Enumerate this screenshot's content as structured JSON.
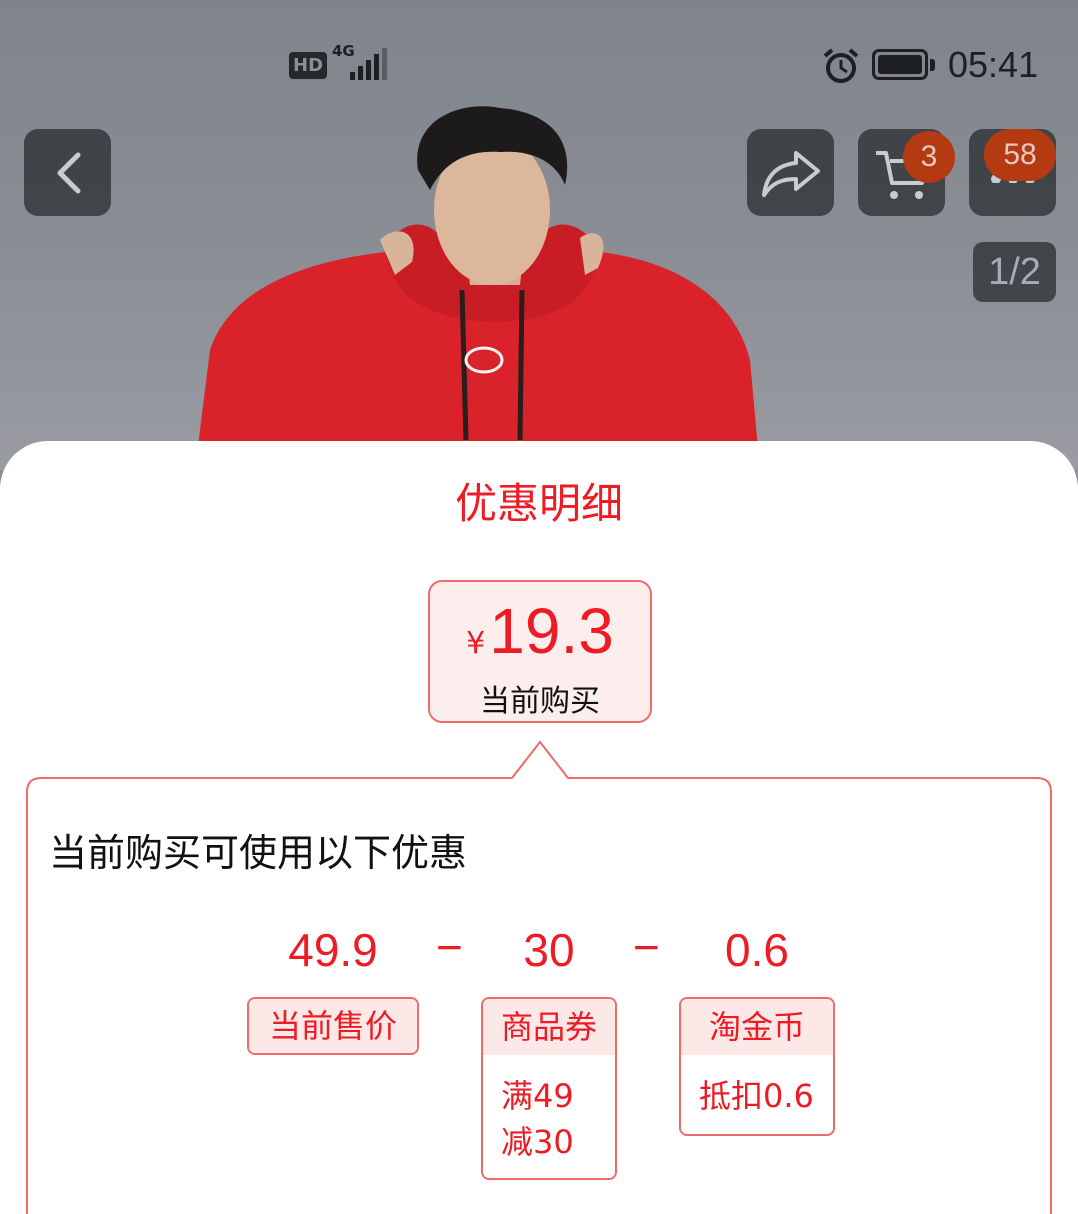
{
  "status_bar": {
    "hd": "HD",
    "network": "4G",
    "time": "05:41"
  },
  "header": {
    "cart_count": "3",
    "more_count": "58",
    "pager": "1/2",
    "icons": [
      "back-icon",
      "share-icon",
      "cart-icon",
      "more-icon"
    ]
  },
  "sheet": {
    "title": "优惠明细",
    "price": {
      "currency": "¥",
      "value": "19.3",
      "caption": "当前购买"
    },
    "panel_title": "当前购买可使用以下优惠",
    "breakdown": {
      "items": [
        {
          "amount": "49.9",
          "label": "当前售价"
        },
        {
          "amount": "30",
          "label": "商品券",
          "detail_line1": "满49",
          "detail_line2": "减30"
        },
        {
          "amount": "0.6",
          "label": "淘金币",
          "detail_line1": "抵扣0.6"
        }
      ],
      "operator": "−"
    }
  },
  "colors": {
    "accent": "#ec1b24",
    "border": "#f06a6a",
    "tint": "#fde8e8",
    "badge": "#b43a12"
  }
}
